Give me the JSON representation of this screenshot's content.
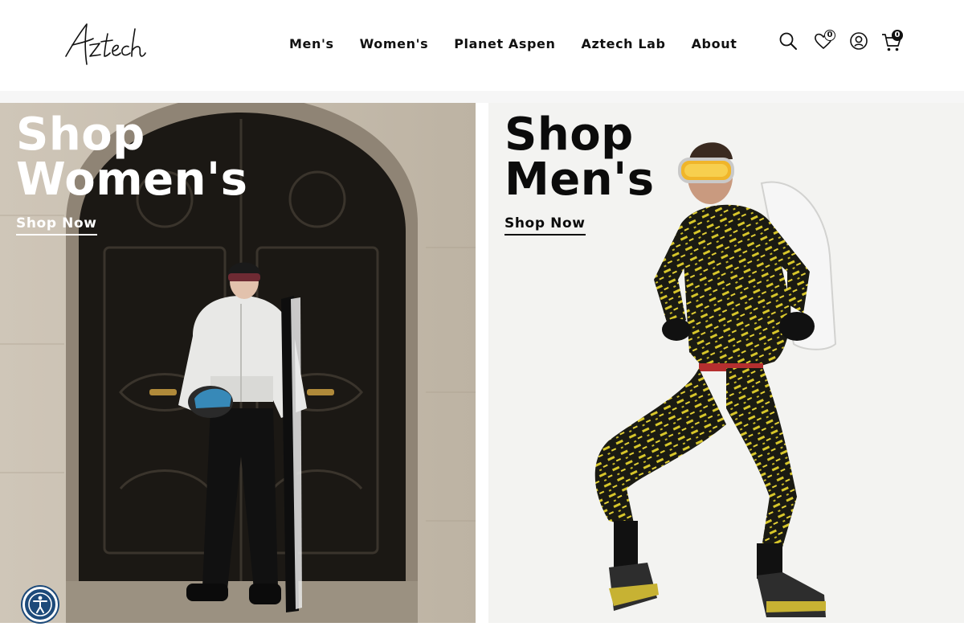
{
  "brand": {
    "logo_text": "Aztech"
  },
  "nav": {
    "items": [
      {
        "label": "Men's"
      },
      {
        "label": "Women's"
      },
      {
        "label": "Planet Aspen"
      },
      {
        "label": "Aztech Lab"
      },
      {
        "label": "About"
      }
    ]
  },
  "header_icons": {
    "search": "search-icon",
    "wishlist": "heart-icon",
    "wishlist_count": "0",
    "account": "user-icon",
    "cart": "cart-icon",
    "cart_count": "0"
  },
  "promos": [
    {
      "line1": "Shop",
      "line2": "Women's",
      "cta": "Shop Now",
      "text_color": "#ffffff"
    },
    {
      "line1": "Shop",
      "line2": "Men's",
      "cta": "Shop Now",
      "text_color": "#0b0b0b"
    }
  ],
  "accessibility": {
    "icon": "accessibility-icon",
    "color": "#1d4a7a"
  }
}
